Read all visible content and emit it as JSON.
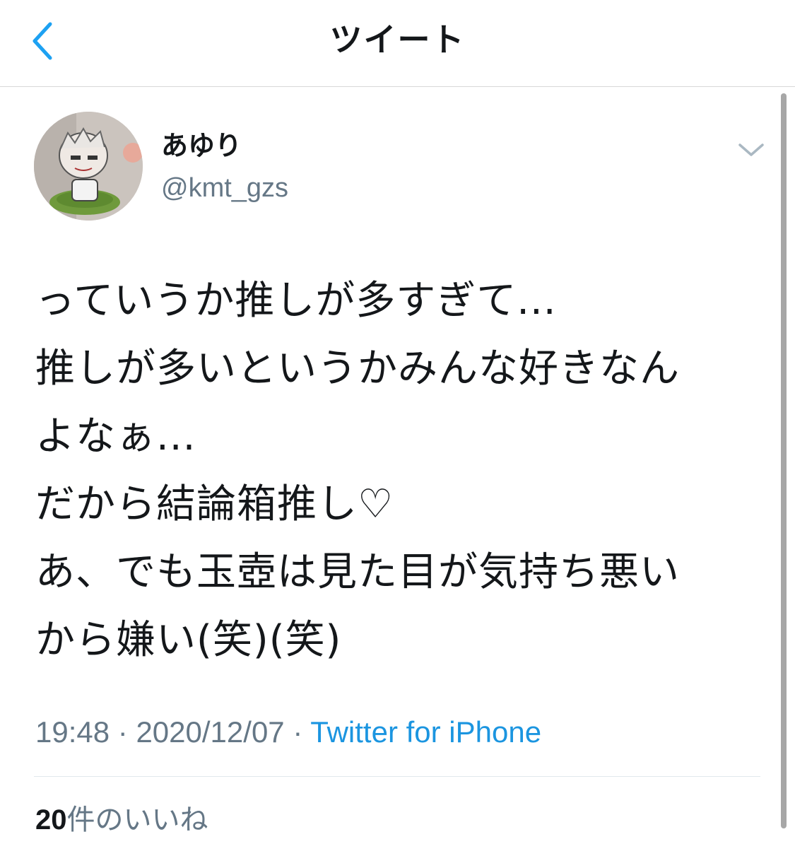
{
  "nav": {
    "back_icon": "chevron-left-icon",
    "title": "ツイート"
  },
  "tweet": {
    "author": {
      "display_name": "あゆり",
      "handle": "@kmt_gzs",
      "avatar_icon": "profile-avatar"
    },
    "menu_icon": "chevron-down-icon",
    "text_lines": [
      "っていうか推しが多すぎて...",
      "推しが多いというかみんな好きなん",
      "よなぁ...",
      "だから結論箱推し♡",
      "あ、でも玉壺は見た目が気持ち悪い",
      "から嫌い(笑)(笑)"
    ],
    "time": "19:48",
    "separator": "·",
    "date": "2020/12/07",
    "source": "Twitter for iPhone",
    "likes_count": "20",
    "likes_label": "件のいいね"
  },
  "colors": {
    "accent": "#1b95e0",
    "text": "#14171a",
    "secondary": "#657786",
    "divider": "#e1e8ed"
  }
}
